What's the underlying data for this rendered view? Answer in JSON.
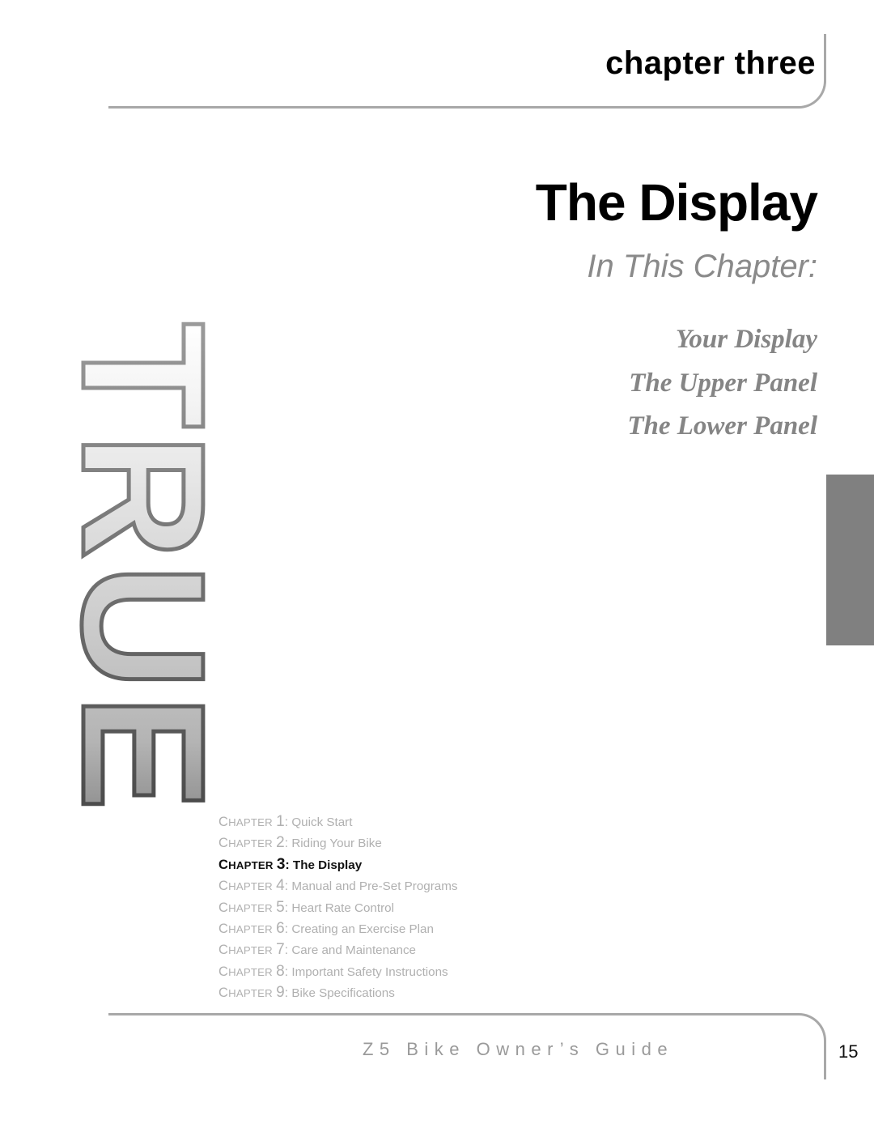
{
  "header": {
    "kicker": "chapter three"
  },
  "title": {
    "heading": "The Display",
    "subheading": "In This Chapter:"
  },
  "topics": [
    {
      "label": "Your Display"
    },
    {
      "label": "The Upper Panel"
    },
    {
      "label": "The Lower Panel"
    }
  ],
  "chapter_index": [
    {
      "label_cap": "C",
      "label_rest": "HAPTER",
      "number": "1",
      "separator": ":",
      "title": "Quick Start",
      "current": false
    },
    {
      "label_cap": "C",
      "label_rest": "HAPTER",
      "number": "2",
      "separator": ":",
      "title": "Riding Your Bike",
      "current": false
    },
    {
      "label_cap": "C",
      "label_rest": "HAPTER",
      "number": "3",
      "separator": ":",
      "title": "The Display",
      "current": true
    },
    {
      "label_cap": "C",
      "label_rest": "HAPTER",
      "number": "4",
      "separator": ":",
      "title": "Manual and Pre-Set Programs",
      "current": false
    },
    {
      "label_cap": "C",
      "label_rest": "HAPTER",
      "number": "5",
      "separator": ":",
      "title": "Heart Rate Control",
      "current": false
    },
    {
      "label_cap": "C",
      "label_rest": "HAPTER",
      "number": "6",
      "separator": ":",
      "title": "Creating an Exercise Plan",
      "current": false
    },
    {
      "label_cap": "C",
      "label_rest": "HAPTER",
      "number": "7",
      "separator": ":",
      "title": "Care and Maintenance",
      "current": false
    },
    {
      "label_cap": "C",
      "label_rest": "HAPTER",
      "number": "8",
      "separator": ":",
      "title": "Important Safety Instructions",
      "current": false
    },
    {
      "label_cap": "C",
      "label_rest": "HAPTER",
      "number": "9",
      "separator": ":",
      "title": "Bike Specifications",
      "current": false
    }
  ],
  "footer": {
    "guide_title": "Z5 Bike Owner’s Guide",
    "page_number": "15"
  },
  "watermark": {
    "brand": "TRUE",
    "orientation": "rotated-180"
  },
  "colors": {
    "rule": "#a8a8a8",
    "thumb_tab": "#808080",
    "muted_text": "#b0b0b0",
    "subheading": "#8a8a8a",
    "topic_text": "#858585",
    "footer_text": "#9a9a9a",
    "title_text": "#000000"
  }
}
